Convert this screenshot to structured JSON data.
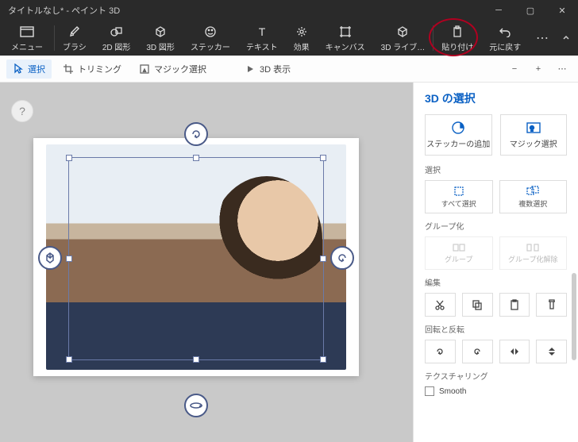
{
  "title": "タイトルなし* - ペイント 3D",
  "ribbon": {
    "menu": "メニュー",
    "brush": "ブラシ",
    "shapes2d": "2D 図形",
    "shapes3d": "3D 図形",
    "sticker": "ステッカー",
    "text": "テキスト",
    "effect": "効果",
    "canvas": "キャンバス",
    "lib3d": "3D ライブ…",
    "paste": "貼り付け",
    "undo": "元に戻す"
  },
  "toolbar": {
    "select": "選択",
    "trimming": "トリミング",
    "magic": "マジック選択",
    "view3d": "3D 表示"
  },
  "side": {
    "heading": "3D の選択",
    "add_sticker": "ステッカーの追加",
    "magic_select": "マジック選択",
    "section_select": "選択",
    "select_all": "すべて選択",
    "multi_select": "複数選択",
    "section_group": "グループ化",
    "group": "グループ",
    "ungroup": "グループ化解除",
    "section_edit": "編集",
    "section_rotate": "回転と反転",
    "section_texture": "テクスチャリング",
    "smooth": "Smooth"
  },
  "help": "?"
}
